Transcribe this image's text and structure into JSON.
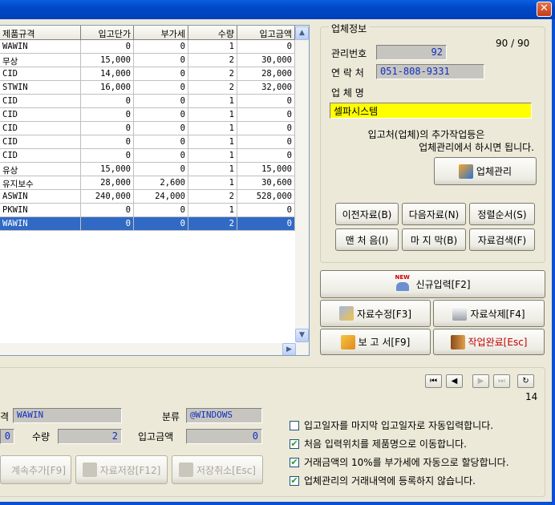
{
  "window": {
    "close_label": "✕"
  },
  "grid": {
    "columns": [
      "제품규격",
      "입고단가",
      "부가세",
      "수량",
      "입고금액"
    ],
    "rows": [
      [
        "WAWIN",
        "0",
        "0",
        "1",
        "0"
      ],
      [
        "무상",
        "15,000",
        "0",
        "2",
        "30,000"
      ],
      [
        "CID",
        "14,000",
        "0",
        "2",
        "28,000"
      ],
      [
        "STWIN",
        "16,000",
        "0",
        "2",
        "32,000"
      ],
      [
        "CID",
        "0",
        "0",
        "1",
        "0"
      ],
      [
        "CID",
        "0",
        "0",
        "1",
        "0"
      ],
      [
        "CID",
        "0",
        "0",
        "1",
        "0"
      ],
      [
        "CID",
        "0",
        "0",
        "1",
        "0"
      ],
      [
        "CID",
        "0",
        "0",
        "1",
        "0"
      ],
      [
        "유상",
        "15,000",
        "0",
        "1",
        "15,000"
      ],
      [
        "유지보수",
        "28,000",
        "2,600",
        "1",
        "30,600"
      ],
      [
        "ASWIN",
        "240,000",
        "24,000",
        "2",
        "528,000"
      ],
      [
        "PKWIN",
        "0",
        "0",
        "1",
        "0"
      ],
      [
        "WAWIN",
        "0",
        "0",
        "2",
        "0"
      ]
    ],
    "selected_row": 13
  },
  "vendor": {
    "legend": "업체정보",
    "counter": "90 / 90",
    "id_label": "관리번호",
    "id_value": "92",
    "phone_label": "연 락 처",
    "phone_value": "051-808-9331",
    "name_label": "업 체 명",
    "name_value": "셀파시스템",
    "note1": "입고처(업체)의 추가작업등은",
    "note2": "업체관리에서 하시면 됩니다.",
    "manage_btn": "업체관리",
    "prev_btn": "이전자료(B)",
    "next_btn": "다음자료(N)",
    "sort_btn": "정렬순서(S)",
    "first_btn": "맨 처 음(I)",
    "last_btn": "마 지 막(B)",
    "search_btn": "자료검색(F)"
  },
  "actions": {
    "new_badge": "NEW",
    "new_btn": "신규입력[F2]",
    "edit_btn": "자료수정[F3]",
    "delete_btn": "자료삭제[F4]",
    "report_btn": "보 고 서[F9]",
    "done_btn": "작업완료[Esc]"
  },
  "form": {
    "record_no": "14",
    "spec_label": "격",
    "spec_value": "WAWIN",
    "category_label": "분류",
    "category_value": "@WINDOWS",
    "price_value": "0",
    "qty_label": "수량",
    "qty_value": "2",
    "amount_label": "입고금액",
    "amount_value": "0",
    "continue_btn": "계속추가[F9]",
    "save_btn": "자료저장[F12]",
    "cancel_btn": "저장취소[Esc]"
  },
  "options": [
    {
      "label": "입고일자를 마지막 입고일자로 자동입력합니다.",
      "checked": false
    },
    {
      "label": "처음 입력위치를 제품명으로 이동합니다.",
      "checked": true
    },
    {
      "label": "거래금액의 10%를 부가세에 자동으로 할당합니다.",
      "checked": true
    },
    {
      "label": "업체관리의 거래내역에 등록하지 않습니다.",
      "checked": true
    }
  ],
  "colors": {
    "selection": "#316ac5",
    "name_field_bg": "#ffff00",
    "done_text": "#c00000"
  }
}
